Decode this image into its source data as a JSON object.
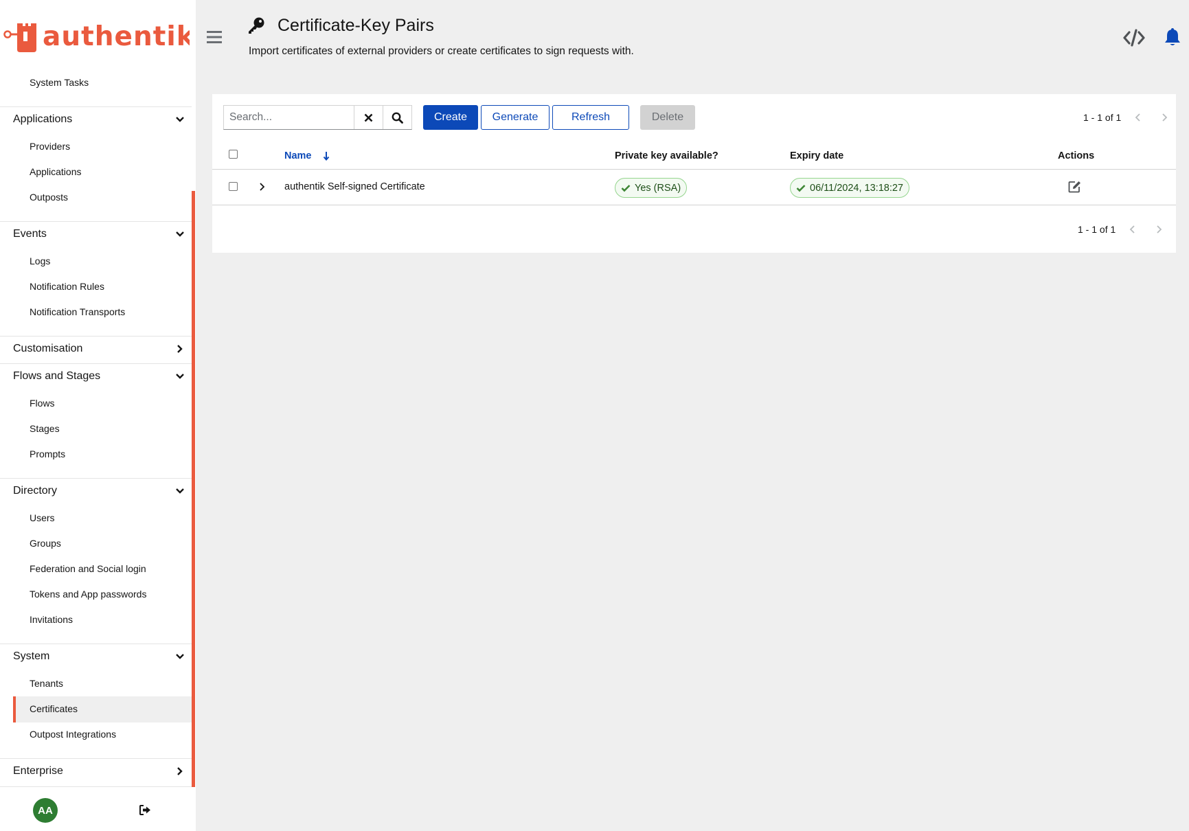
{
  "brand": {
    "name": "authentik",
    "color": "#ea5a3e"
  },
  "sidebar": {
    "top_item": "System Tasks",
    "groups": [
      {
        "label": "Applications",
        "expanded": true,
        "items": [
          "Providers",
          "Applications",
          "Outposts"
        ]
      },
      {
        "label": "Events",
        "expanded": true,
        "items": [
          "Logs",
          "Notification Rules",
          "Notification Transports"
        ]
      },
      {
        "label": "Customisation",
        "expanded": false,
        "items": []
      },
      {
        "label": "Flows and Stages",
        "expanded": true,
        "items": [
          "Flows",
          "Stages",
          "Prompts"
        ]
      },
      {
        "label": "Directory",
        "expanded": true,
        "items": [
          "Users",
          "Groups",
          "Federation and Social login",
          "Tokens and App passwords",
          "Invitations"
        ]
      },
      {
        "label": "System",
        "expanded": true,
        "items": [
          "Tenants",
          "Certificates",
          "Outpost Integrations"
        ]
      },
      {
        "label": "Enterprise",
        "expanded": false,
        "items": []
      }
    ],
    "active_item": "Certificates",
    "user_initials": "AA"
  },
  "header": {
    "title": "Certificate-Key Pairs",
    "description": "Import certificates of external providers or create certificates to sign requests with."
  },
  "toolbar": {
    "search_placeholder": "Search...",
    "create_label": "Create",
    "generate_label": "Generate",
    "refresh_label": "Refresh",
    "delete_label": "Delete"
  },
  "pagination": {
    "top": "1 - 1 of 1",
    "bottom": "1 - 1 of 1"
  },
  "table": {
    "columns": [
      "Name",
      "Private key available?",
      "Expiry date",
      "Actions"
    ],
    "rows": [
      {
        "name": "authentik Self-signed Certificate",
        "private_key": "Yes (RSA)",
        "expiry": "06/11/2024, 13:18:27"
      }
    ]
  },
  "colors": {
    "primary": "#0c49b8",
    "accent": "#ea5a3e",
    "success": "#3e8635"
  }
}
